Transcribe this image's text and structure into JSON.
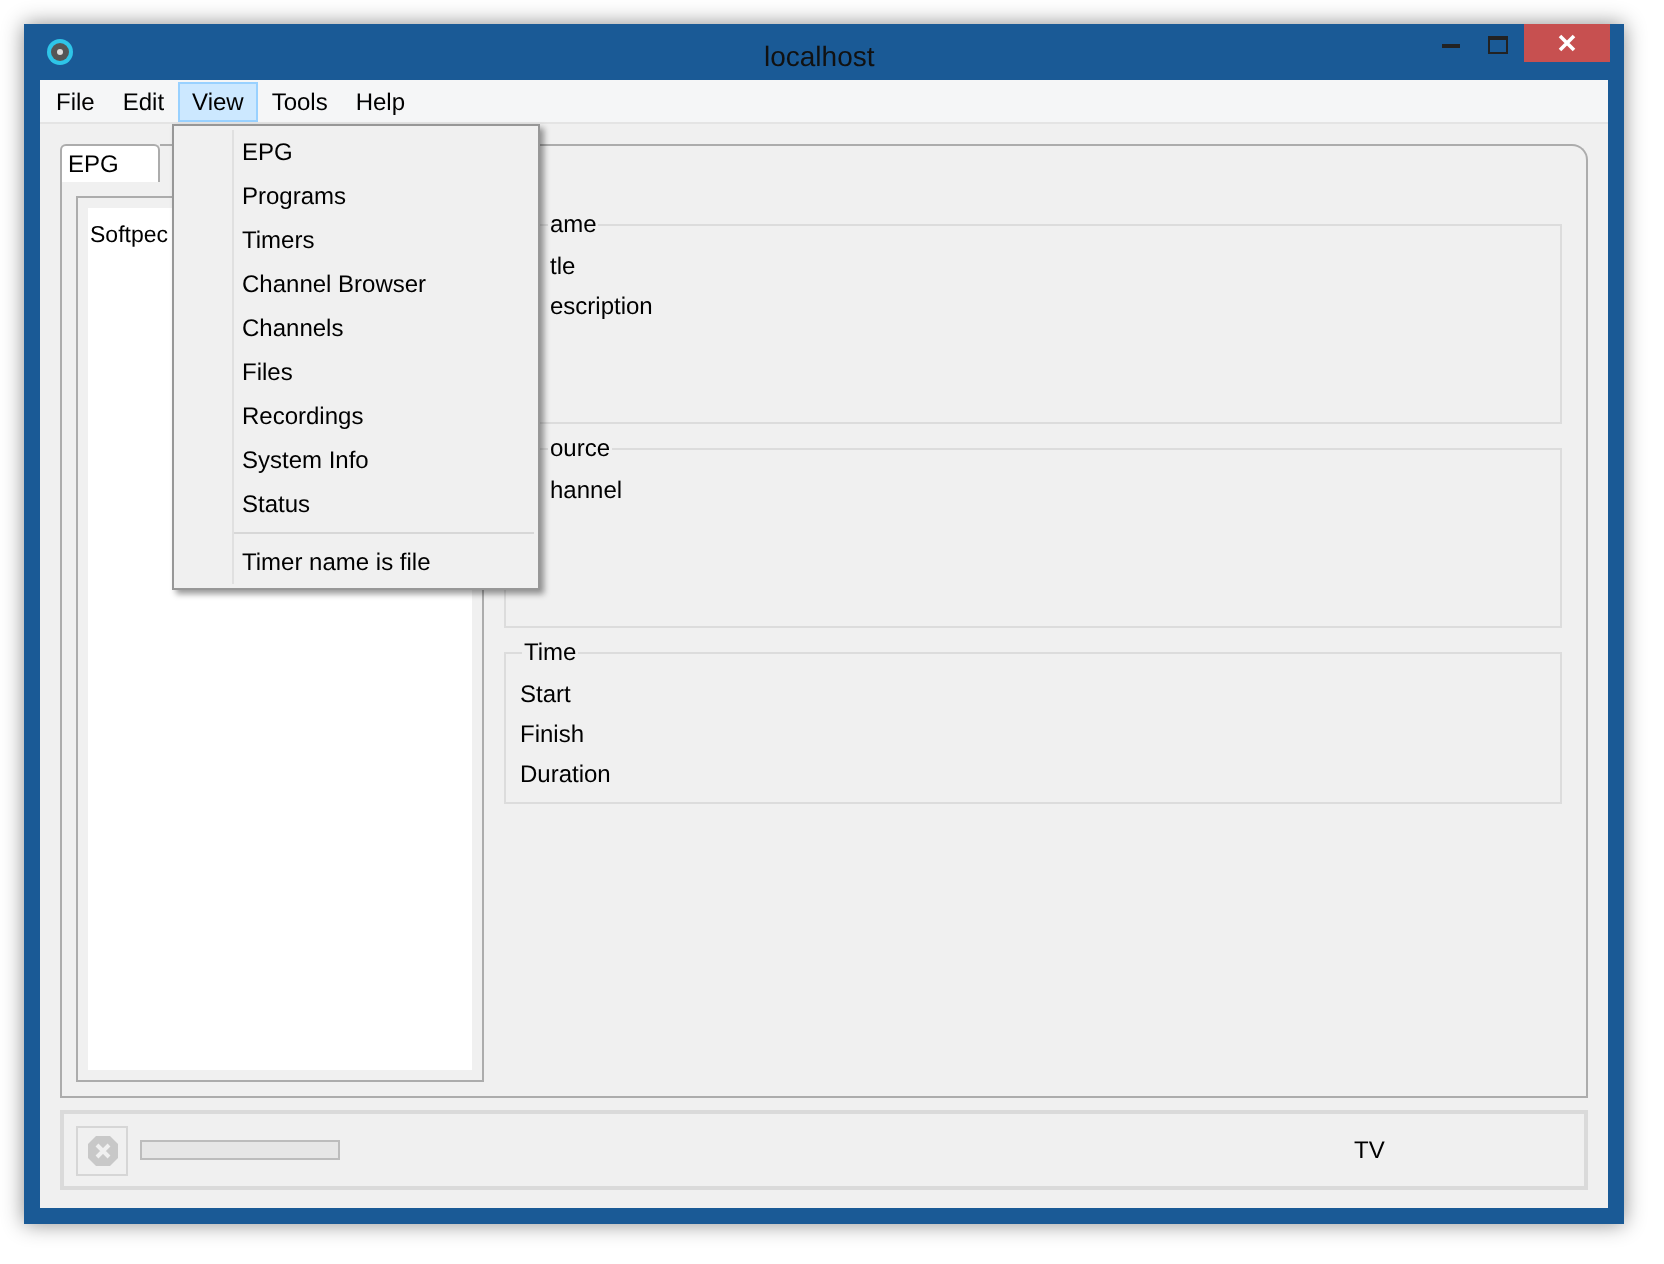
{
  "window": {
    "title": "localhost"
  },
  "menu_bar": [
    {
      "label": "File",
      "selected": false
    },
    {
      "label": "Edit",
      "selected": false
    },
    {
      "label": "View",
      "selected": true
    },
    {
      "label": "Tools",
      "selected": false
    },
    {
      "label": "Help",
      "selected": false
    }
  ],
  "view_menu": {
    "items": [
      {
        "label": "EPG",
        "kind": "item"
      },
      {
        "label": "Programs",
        "kind": "item"
      },
      {
        "label": "Timers",
        "kind": "item"
      },
      {
        "label": "Channel Browser",
        "kind": "item"
      },
      {
        "label": "Channels",
        "kind": "item"
      },
      {
        "label": "Files",
        "kind": "item"
      },
      {
        "label": "Recordings",
        "kind": "item"
      },
      {
        "label": "System Info",
        "kind": "item"
      },
      {
        "label": "Status",
        "kind": "item"
      },
      {
        "kind": "separator"
      },
      {
        "label": "Timer name is file",
        "kind": "item"
      }
    ]
  },
  "tabs": [
    {
      "label": "EPG",
      "selected": true
    }
  ],
  "tree": {
    "items": [
      {
        "label": "Softpec"
      }
    ]
  },
  "groups": [
    {
      "title": "ame",
      "fields": [
        "tle",
        "escription"
      ]
    },
    {
      "title": "ource",
      "fields": [
        "hannel"
      ]
    },
    {
      "title": "Time",
      "fields": [
        "Start",
        "Finish",
        "Duration"
      ]
    }
  ],
  "status_bar": {
    "progress": {
      "level": 0
    },
    "text": "TV"
  }
}
